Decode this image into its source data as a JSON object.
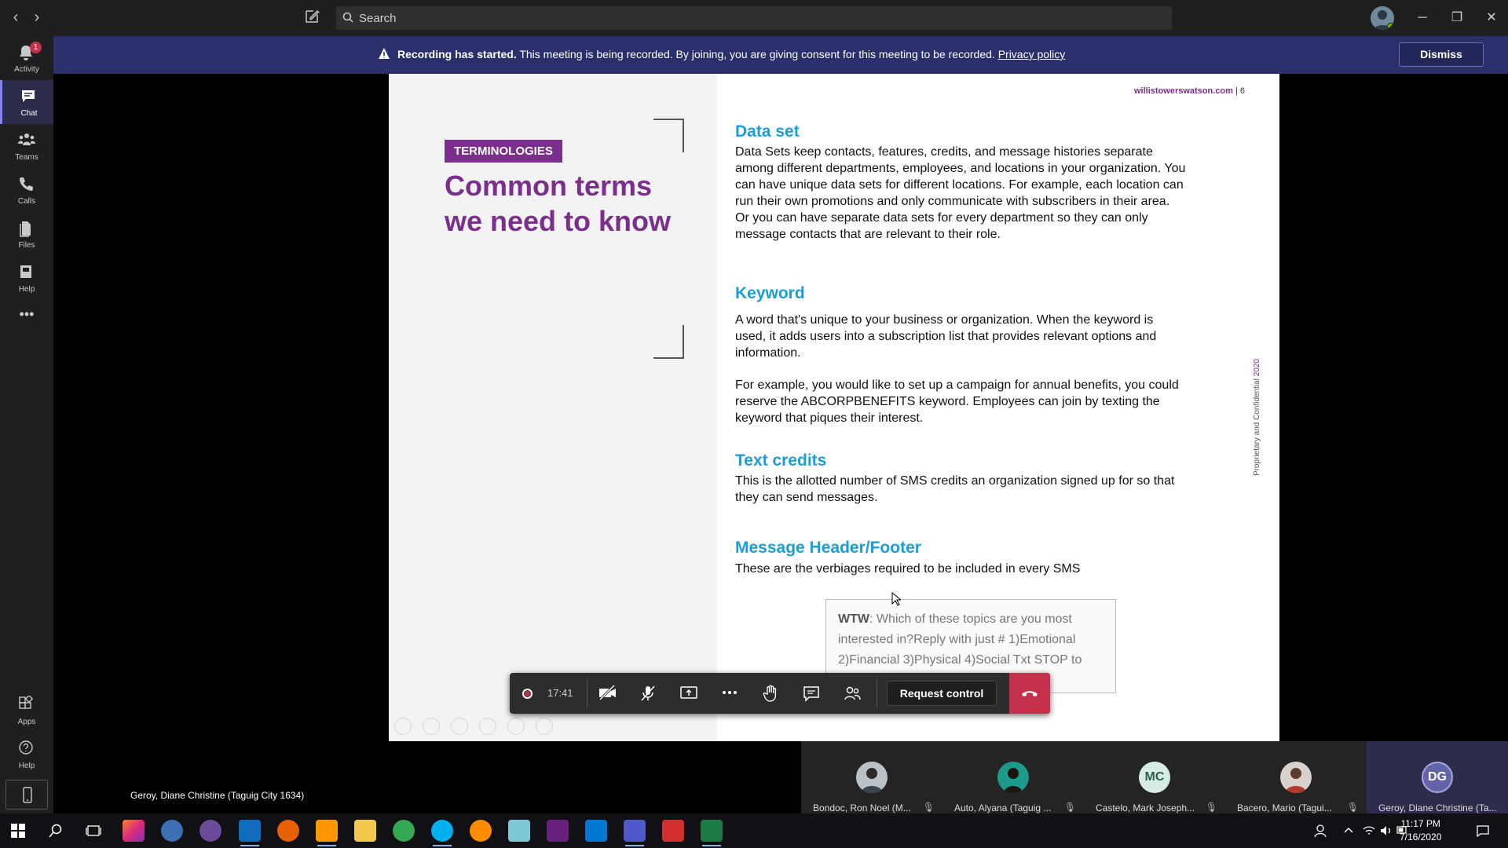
{
  "app": {
    "search_placeholder": "Search"
  },
  "rail": {
    "items": [
      {
        "label": "Activity",
        "badge": "1"
      },
      {
        "label": "Chat"
      },
      {
        "label": "Teams"
      },
      {
        "label": "Calls"
      },
      {
        "label": "Files"
      },
      {
        "label": "Help"
      }
    ],
    "more_label": "•••",
    "apps_label": "Apps",
    "help_label": "Help"
  },
  "banner": {
    "bold": "Recording has started.",
    "text": " This meeting is being recorded. By joining, you are giving consent for this meeting to be recorded. ",
    "link": "Privacy policy",
    "dismiss": "Dismiss"
  },
  "slide": {
    "tag": "TERMINOLOGIES",
    "headline": "Common terms we need to know",
    "site": "willistowerswatson.com",
    "page": " | 6",
    "vertical": "Proprietary and Confidential",
    "vertical_year": " 2020",
    "sections": [
      {
        "heading": "Data set",
        "body": "Data Sets keep contacts, features, credits, and message histories separate among different departments, employees, and locations in your organization. You can have unique data sets for different locations. For example, each location can run their own promotions and only communicate with subscribers in their area. Or you can have separate data sets for every department so they can only message contacts that are relevant to their role."
      },
      {
        "heading": "Keyword",
        "body": "A word that's unique to your business or organization. When the keyword is used, it adds users into a subscription list that provides relevant options and information.",
        "body2": "For example, you would like to set up a campaign for annual benefits, you could reserve the ABCORPBENEFITS keyword. Employees can join by texting the keyword that piques their interest."
      },
      {
        "heading": "Text credits",
        "body": "This is the allotted number of SMS credits an organization signed up for so that they can send messages."
      },
      {
        "heading": "Message Header/Footer",
        "body": "These are the verbiages required to be included in every SMS"
      }
    ],
    "sms_sender": "WTW",
    "sms_text": ": Which of these topics are you most interested in?Reply with just # 1)Emotional 2)Financial 3)Physical 4)Social Txt STOP to OptOut"
  },
  "presenter_name": "Geroy, Diane Christine (Taguig City 1634)",
  "controls": {
    "timer": "17:41",
    "request_control": "Request control"
  },
  "participants": [
    {
      "name": "Bondoc, Ron Noel (M...",
      "avatar": "photo",
      "color": "#4a5560"
    },
    {
      "name": "Auto, Alyana (Taguig ...",
      "avatar": "photo",
      "color": "#1e9a8a"
    },
    {
      "name": "Castelo, Mark Joseph...",
      "avatar": "initials",
      "initials": "MC"
    },
    {
      "name": "Bacero, Mario (Tagui...",
      "avatar": "photo",
      "color": "#8a5a48"
    },
    {
      "name": "Geroy, Diane Christine (Ta...",
      "avatar": "initials",
      "initials": "DG"
    }
  ],
  "taskbar": {
    "time": "11:17 PM",
    "date": "7/16/2020"
  }
}
